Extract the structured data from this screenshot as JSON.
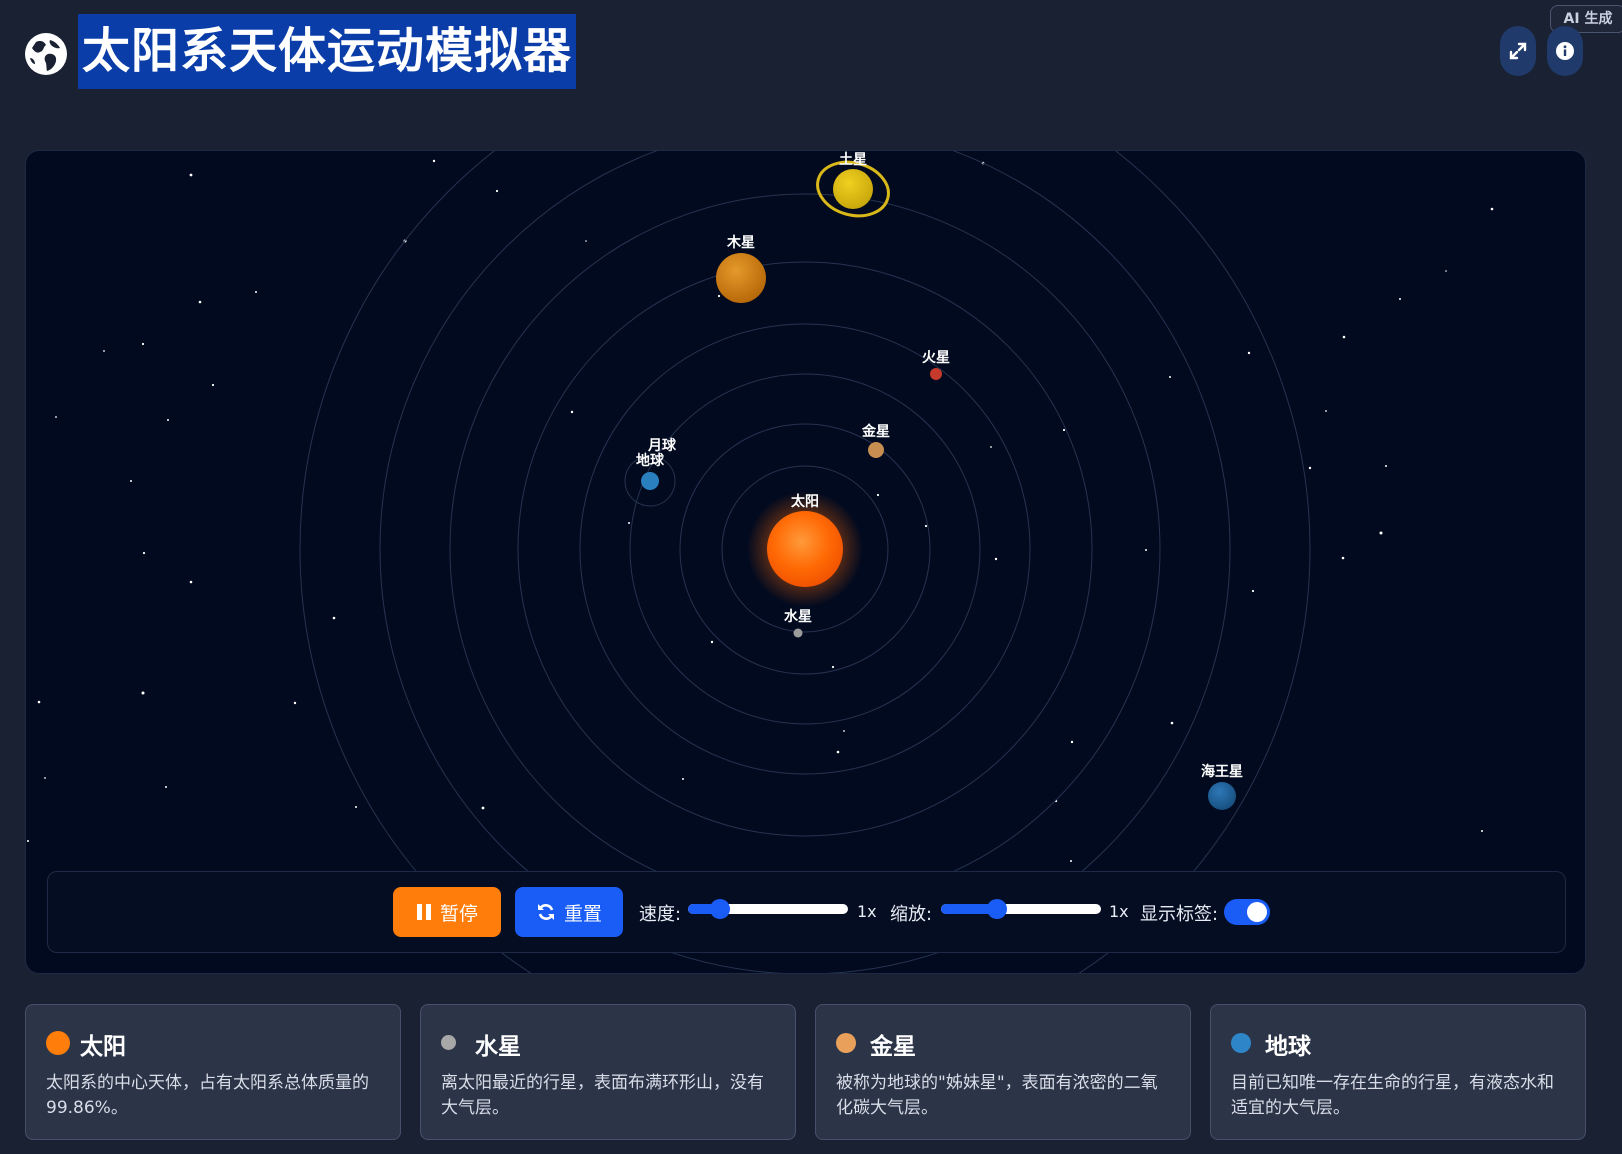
{
  "badge": "AI 生成",
  "header": {
    "title": "太阳系天体运动模拟器"
  },
  "bodies": {
    "sun": "太阳",
    "mercury": "水星",
    "venus": "金星",
    "earth": "地球",
    "moon": "月球",
    "mars": "火星",
    "jupiter": "木星",
    "saturn": "土星",
    "neptune": "海王星"
  },
  "controls": {
    "pause_label": "暂停",
    "reset_label": "重置",
    "speed_label": "速度:",
    "speed_value": "1x",
    "speed_level": 0.2,
    "zoom_label": "缩放:",
    "zoom_value": "1x",
    "zoom_level": 0.35,
    "labels_label": "显示标签:",
    "labels_on": true
  },
  "cards": [
    {
      "name": "太阳",
      "color": "#ff7d0a",
      "desc": "太阳系的中心天体，占有太阳系总体质量的99.86%。"
    },
    {
      "name": "水星",
      "color": "#a8a8a8",
      "desc": "离太阳最近的行星，表面布满环形山，没有大气层。"
    },
    {
      "name": "金星",
      "color": "#e8a05a",
      "desc": "被称为地球的\"姊妹星\"，表面有浓密的二氧化碳大气层。"
    },
    {
      "name": "地球",
      "color": "#2e86c9",
      "desc": "目前已知唯一存在生命的行星，有液态水和适宜的大气层。"
    }
  ],
  "colors": {
    "accent": "#1a5cf6",
    "pause": "#ff7d0a",
    "space": "#020a1f"
  }
}
